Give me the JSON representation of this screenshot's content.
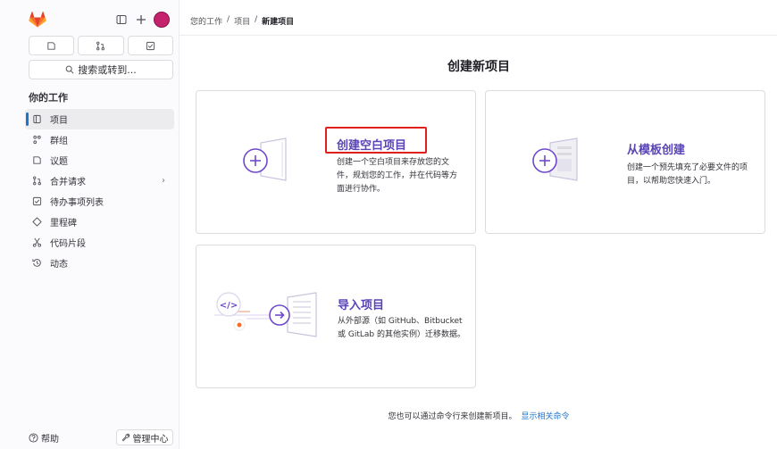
{
  "sidebar": {
    "search_label": "搜索或转到...",
    "section_heading": "你的工作",
    "items": [
      {
        "label": "项目",
        "icon": "project-icon",
        "active": true
      },
      {
        "label": "群组",
        "icon": "group-icon"
      },
      {
        "label": "议题",
        "icon": "issues-icon"
      },
      {
        "label": "合并请求",
        "icon": "merge-request-icon",
        "has_chevron": true
      },
      {
        "label": "待办事项列表",
        "icon": "todo-icon"
      },
      {
        "label": "里程碑",
        "icon": "milestone-icon"
      },
      {
        "label": "代码片段",
        "icon": "snippet-icon"
      },
      {
        "label": "动态",
        "icon": "activity-icon"
      }
    ],
    "help_label": "帮助",
    "admin_label": "管理中心"
  },
  "breadcrumb": {
    "items": [
      "您的工作",
      "项目",
      "新建项目"
    ],
    "separator": "/"
  },
  "page_title": "创建新项目",
  "cards": {
    "blank": {
      "title": "创建空白项目",
      "desc_lines": [
        "创建一个空白项目来存放您的文",
        "件，规划您的工作，并在代码等方",
        "面进行协作。"
      ]
    },
    "template": {
      "title": "从模板创建",
      "desc_lines": [
        "创建一个预先填充了必要文件的项",
        "目，以帮助您快速入门。"
      ]
    },
    "import": {
      "title": "导入项目",
      "desc_lines": [
        "从外部源（如 GitHub、Bitbucket",
        "或 GitLab 的其他实例）迁移数据。"
      ]
    }
  },
  "footer": {
    "text": "您也可以通过命令行来创建新项目。",
    "link": "显示相关命令"
  },
  "colors": {
    "accent_purple": "#5943b6",
    "link_blue": "#1f75cb",
    "highlight_red": "#e0201a",
    "logo_orange": "#fc6d26"
  }
}
